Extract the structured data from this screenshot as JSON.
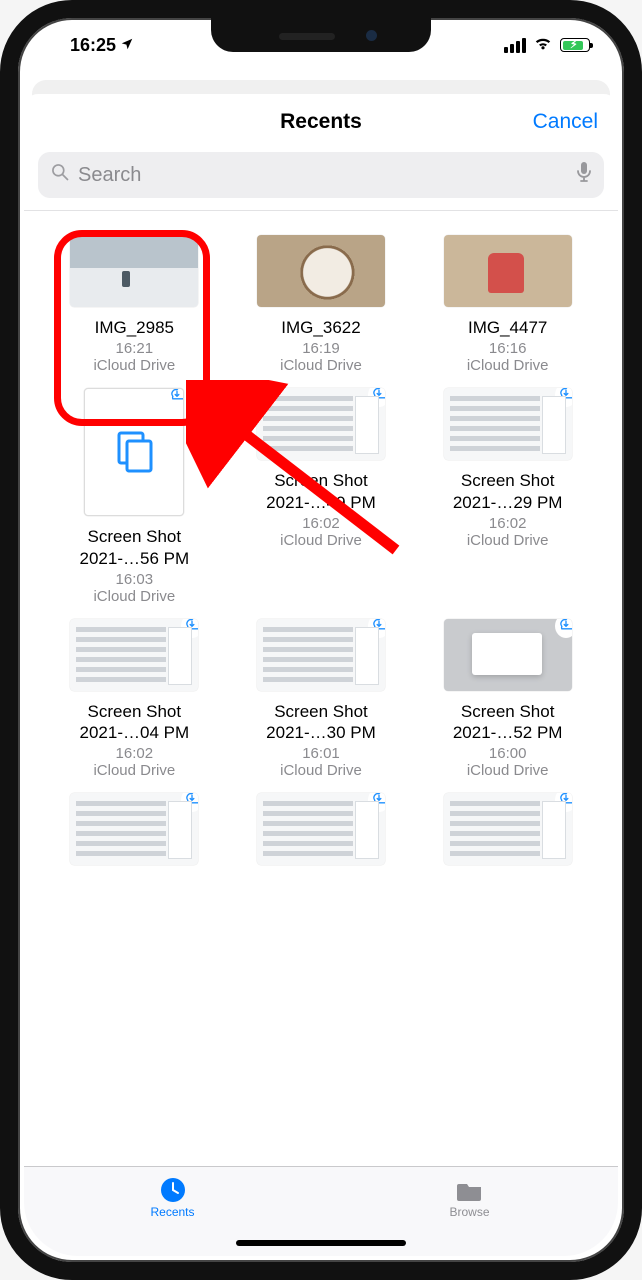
{
  "statusbar": {
    "time": "16:25"
  },
  "nav": {
    "title": "Recents",
    "cancel": "Cancel"
  },
  "search": {
    "placeholder": "Search"
  },
  "files": [
    {
      "name": "IMG_2985",
      "time": "16:21",
      "loc": "iCloud Drive",
      "thumb": "snow",
      "cloud": false,
      "tall": false
    },
    {
      "name": "IMG_3622",
      "time": "16:19",
      "loc": "iCloud Drive",
      "thumb": "dog",
      "cloud": false,
      "tall": false
    },
    {
      "name": "IMG_4477",
      "time": "16:16",
      "loc": "iCloud Drive",
      "thumb": "sofa",
      "cloud": false,
      "tall": false
    },
    {
      "name": "Screen Shot 2021-…56 PM",
      "time": "16:03",
      "loc": "iCloud Drive",
      "thumb": "copy",
      "cloud": true,
      "tall": true
    },
    {
      "name": "Screen Shot 2021-…49 PM",
      "time": "16:02",
      "loc": "iCloud Drive",
      "thumb": "shot",
      "cloud": true,
      "tall": false
    },
    {
      "name": "Screen Shot 2021-…29 PM",
      "time": "16:02",
      "loc": "iCloud Drive",
      "thumb": "shot",
      "cloud": true,
      "tall": false
    },
    {
      "name": "Screen Shot 2021-…04 PM",
      "time": "16:02",
      "loc": "iCloud Drive",
      "thumb": "shot",
      "cloud": true,
      "tall": false
    },
    {
      "name": "Screen Shot 2021-…30 PM",
      "time": "16:01",
      "loc": "iCloud Drive",
      "thumb": "shot",
      "cloud": true,
      "tall": false
    },
    {
      "name": "Screen Shot 2021-…52 PM",
      "time": "16:00",
      "loc": "iCloud Drive",
      "thumb": "shotdark",
      "cloud": true,
      "tall": false
    },
    {
      "name": "",
      "time": "",
      "loc": "",
      "thumb": "shot",
      "cloud": true,
      "tall": false
    },
    {
      "name": "",
      "time": "",
      "loc": "",
      "thumb": "shot",
      "cloud": true,
      "tall": false
    },
    {
      "name": "",
      "time": "",
      "loc": "",
      "thumb": "shot",
      "cloud": true,
      "tall": false
    }
  ],
  "tabs": {
    "recents": "Recents",
    "browse": "Browse"
  }
}
